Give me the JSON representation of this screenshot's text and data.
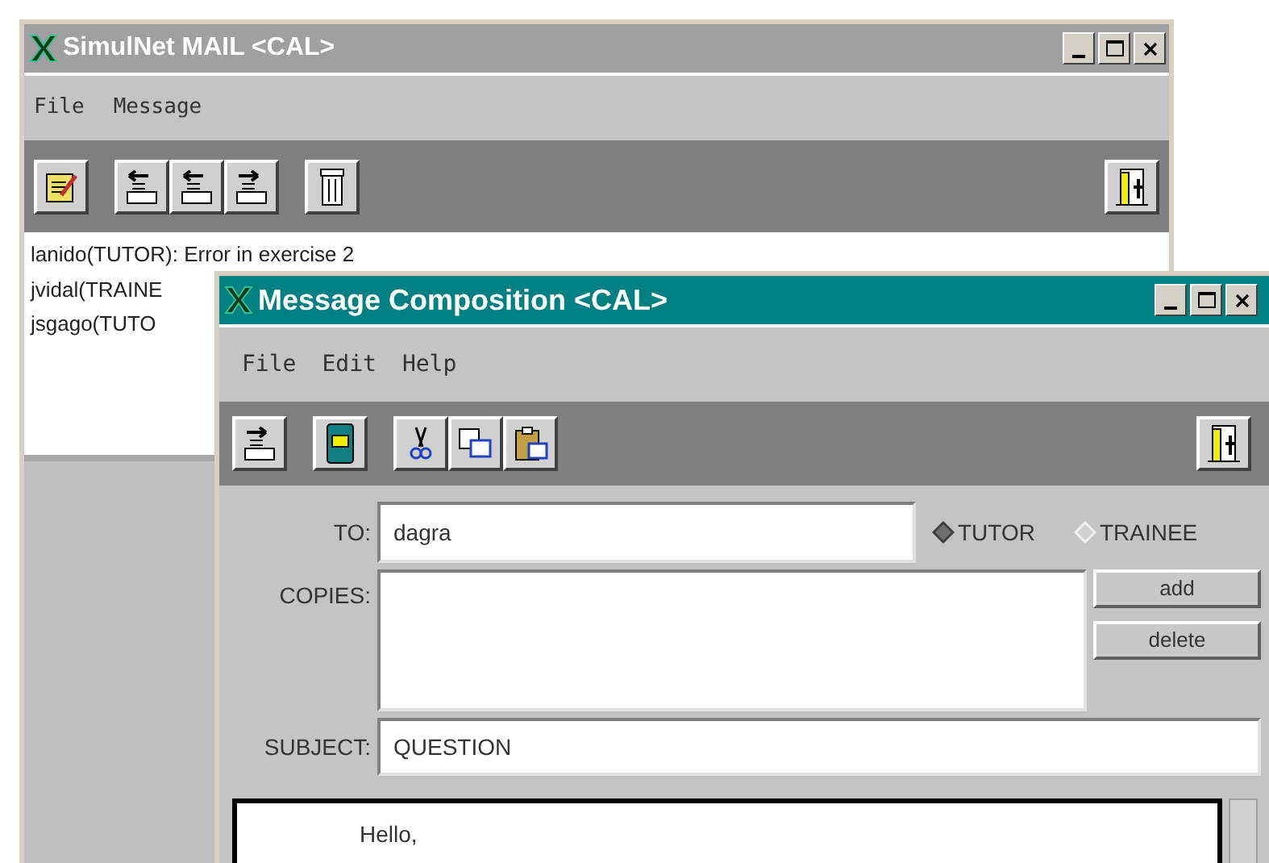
{
  "mail_window": {
    "title": "SimulNet MAIL <CAL>",
    "menu": [
      "File",
      "Message"
    ],
    "messages": [
      "lanido(TUTOR): Error in exercise 2",
      "jvidal(TRAINE",
      "jsgago(TUTO"
    ]
  },
  "compose_window": {
    "title": "Message Composition <CAL>",
    "menu": [
      "File",
      "Edit",
      "Help"
    ],
    "to": {
      "label": "TO:",
      "value": "dagra"
    },
    "recipient_types": [
      {
        "label": "TUTOR",
        "selected": true
      },
      {
        "label": "TRAINEE",
        "selected": false
      }
    ],
    "copies": {
      "label": "COPIES:"
    },
    "buttons": [
      "add",
      "delete"
    ],
    "subject": {
      "label": "SUBJECT:",
      "value": "QUESTION"
    },
    "body": "Hello,"
  }
}
